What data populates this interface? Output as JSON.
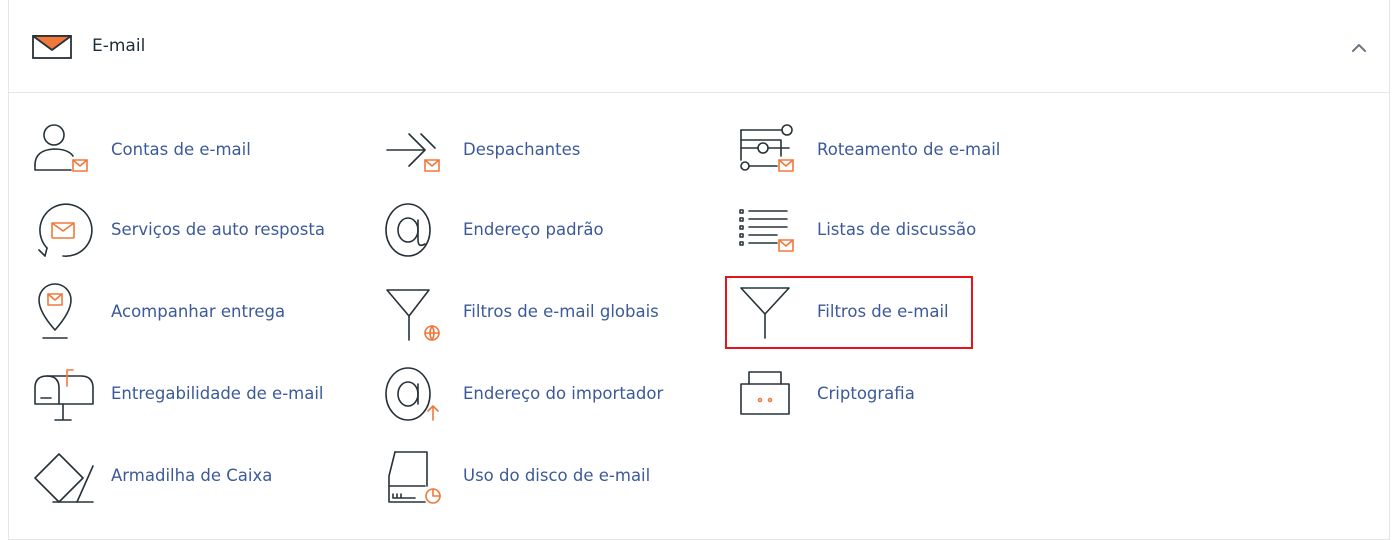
{
  "section": {
    "title": "E-mail",
    "icon": "envelope-icon",
    "collapse_icon": "chevron-up-icon",
    "accent_color": "#f0783c",
    "link_color": "#3c5a9a"
  },
  "items": [
    {
      "label": "Contas de e-mail",
      "icon": "email-accounts-icon"
    },
    {
      "label": "Despachantes",
      "icon": "forwarders-icon"
    },
    {
      "label": "Roteamento de e-mail",
      "icon": "email-routing-icon"
    },
    {
      "label": "Serviços de auto resposta",
      "icon": "autoresponders-icon"
    },
    {
      "label": "Endereço padrão",
      "icon": "default-address-icon"
    },
    {
      "label": "Listas de discussão",
      "icon": "mailing-lists-icon"
    },
    {
      "label": "Acompanhar entrega",
      "icon": "track-delivery-icon"
    },
    {
      "label": "Filtros de e-mail globais",
      "icon": "global-email-filters-icon"
    },
    {
      "label": "Filtros de e-mail",
      "icon": "email-filters-icon",
      "highlighted": true
    },
    {
      "label": "Entregabilidade de e-mail",
      "icon": "email-deliverability-icon"
    },
    {
      "label": "Endereço do importador",
      "icon": "address-importer-icon"
    },
    {
      "label": "Criptografia",
      "icon": "encryption-icon"
    },
    {
      "label": "Armadilha de Caixa",
      "icon": "boxtrapper-icon"
    },
    {
      "label": "Uso do disco de e-mail",
      "icon": "email-disk-usage-icon"
    }
  ]
}
